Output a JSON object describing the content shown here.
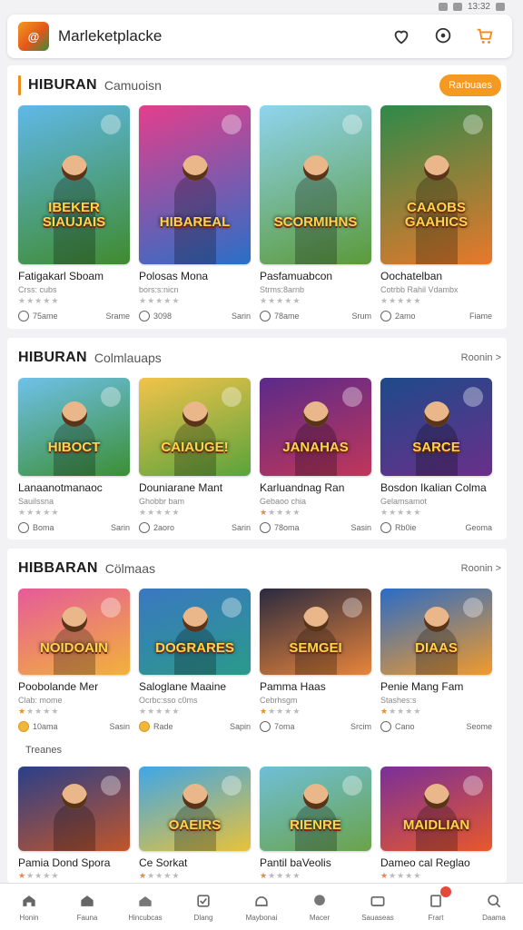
{
  "status": {
    "time": "13:32"
  },
  "header": {
    "logo_text": "@",
    "title": "Marleketplacke"
  },
  "sections": [
    {
      "title": "HIBURAN",
      "subtitle": "Camuoisn",
      "action": "Rarbuaes",
      "items": [
        {
          "art": "IBEKER SIAUJAIS",
          "title": "Fatigakarl Sboam",
          "sub": "Crss: cubs",
          "rating": 0,
          "likes": "75ame",
          "meta": "Srame",
          "c1": "#5fb8e8",
          "c2": "#3f8b2e"
        },
        {
          "art": "HIBAREAL",
          "title": "Polosas Mona",
          "sub": "bors:s:nicn",
          "rating": 0,
          "likes": "3098",
          "meta": "Sarin",
          "c1": "#e43e8c",
          "c2": "#2a6fc7"
        },
        {
          "art": "SCORMIHNS",
          "title": "Pasfamuabcon",
          "sub": "Strms:8arnb",
          "rating": 0,
          "likes": "78ame",
          "meta": "Srum",
          "c1": "#8fd4ef",
          "c2": "#5b9a3a"
        },
        {
          "art": "CAAOBS GAAHICS",
          "title": "Oochatelban",
          "sub": "Cotrbb Rahil Vdambx",
          "rating": 0,
          "likes": "2amo",
          "meta": "Fiame",
          "c1": "#2d8a4a",
          "c2": "#e8782a"
        }
      ]
    },
    {
      "title": "HIBURAN",
      "subtitle": "Colmlauaps",
      "action": "Roonin >",
      "items": [
        {
          "art": "HIBOCT",
          "title": "Lanaanotmanaoc",
          "sub": "Sauilssna",
          "rating": 0,
          "likes": "Boma",
          "meta": "Sarin",
          "c1": "#6fc1ea",
          "c2": "#3b8f34"
        },
        {
          "art": "CAIAUGE!",
          "title": "Douniarane Mant",
          "sub": "Ghobbr bam",
          "rating": 0,
          "likes": "2aoro",
          "meta": "Sarin",
          "c1": "#f2c34a",
          "c2": "#5aa33c"
        },
        {
          "art": "JANAHAS",
          "title": "Karluandnag Ran",
          "sub": "Gebaoo chia",
          "rating": 1,
          "likes": "78oma",
          "meta": "Sasin",
          "c1": "#5b2a8a",
          "c2": "#c0365a"
        },
        {
          "art": "SARCE",
          "title": "Bosdon Ikalian Colma",
          "sub": "Gelamsamot",
          "rating": 0,
          "likes": "Rb0ie",
          "meta": "Geoma",
          "c1": "#1e4a8a",
          "c2": "#6a2f8a"
        }
      ]
    },
    {
      "title": "HIBBARAN",
      "subtitle": "Cölmaas",
      "action": "Roonin >",
      "items": [
        {
          "art": "NOIDOAIN",
          "title": "Poobolande Mer",
          "sub": "Clab: mome",
          "rating": 1,
          "likes": "10ama",
          "meta": "Sasin",
          "c1": "#e65a9a",
          "c2": "#f2b23a"
        },
        {
          "art": "DOGRARES",
          "title": "Saloglane Maaine",
          "sub": "Ocrbc:sso c0ms",
          "rating": 0,
          "likes": "Rade",
          "meta": "Sapin",
          "c1": "#3a78c2",
          "c2": "#2a9a8a"
        },
        {
          "art": "SEMGEI",
          "title": "Pamma Haas",
          "sub": "Cebrhsgm",
          "rating": 1,
          "likes": "7oma",
          "meta": "Srcim",
          "c1": "#2a2a40",
          "c2": "#e8843a"
        },
        {
          "art": "DIAAS",
          "title": "Penie Mang Fam",
          "sub": "Stashes:s",
          "rating": 1,
          "likes": "Cano",
          "meta": "Seome",
          "c1": "#2a6cc7",
          "c2": "#f29a2a"
        }
      ]
    },
    {
      "title": "Treanes",
      "subtitle": "",
      "action": "",
      "items": [
        {
          "art": "",
          "title": "Pamia Dond Spora",
          "sub": "",
          "rating": 1,
          "likes": "",
          "meta": "",
          "c1": "#2a3f8a",
          "c2": "#c0562a"
        },
        {
          "art": "OAEIRS",
          "title": "Ce Sorkat",
          "sub": "",
          "rating": 1,
          "likes": "",
          "meta": "",
          "c1": "#3fa6e8",
          "c2": "#e8c23a"
        },
        {
          "art": "RIENRE",
          "title": "Pantil baVeolis",
          "sub": "",
          "rating": 1,
          "likes": "",
          "meta": "",
          "c1": "#6fbfd8",
          "c2": "#6aa34a"
        },
        {
          "art": "MAIDLIAN",
          "title": "Dameo cal Reglao",
          "sub": "",
          "rating": 1,
          "likes": "",
          "meta": "",
          "c1": "#7a2f9a",
          "c2": "#e8582a"
        }
      ]
    }
  ],
  "tabs": [
    "Honin",
    "Fauna",
    "Hincubcas",
    "Dlang",
    "Maybonai",
    "Macer",
    "Sauaseas",
    "Frart",
    "Daama"
  ]
}
